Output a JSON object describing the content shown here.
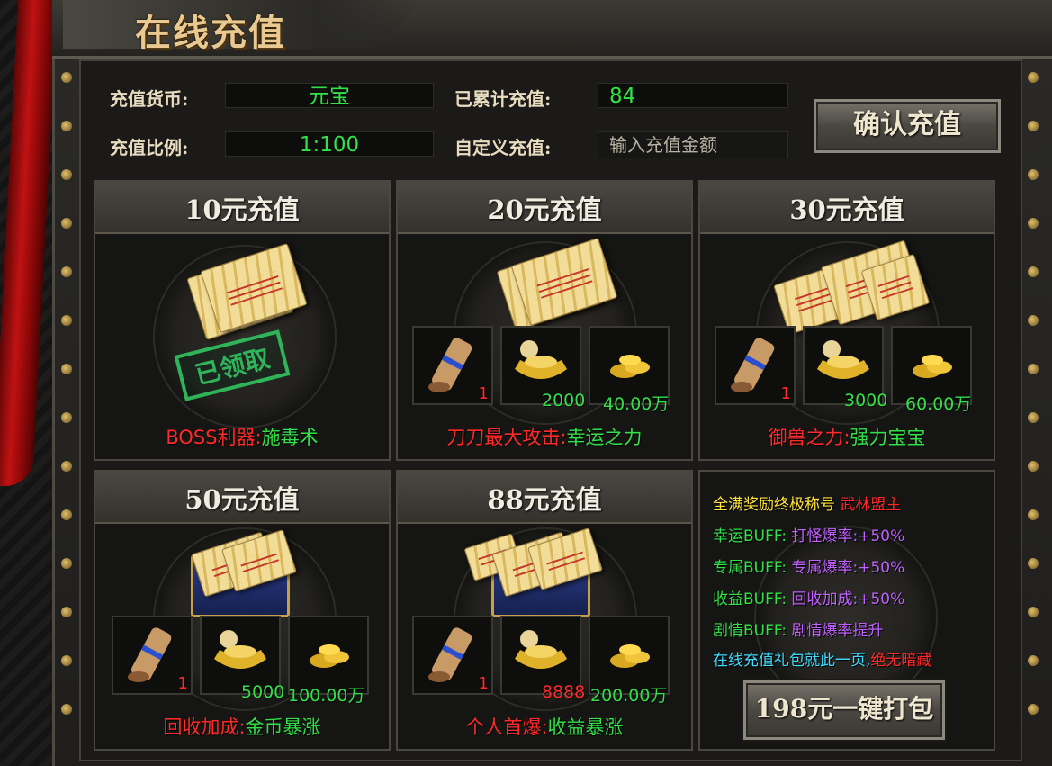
{
  "window": {
    "title": "在线充值"
  },
  "form": {
    "currency_label": "充值货币:",
    "currency_value": "元宝",
    "ratio_label": "充值比例:",
    "ratio_value": "1:100",
    "total_label": "已累计充值:",
    "total_value": "84",
    "custom_label": "自定义充值:",
    "custom_placeholder": "输入充值金额",
    "confirm_label": "确认充值"
  },
  "tiers": [
    {
      "title": "10元充值",
      "status": "已领取",
      "reward_prefix": "BOSS利器:",
      "reward_value": "施毒术"
    },
    {
      "title": "20元充值",
      "items": [
        {
          "icon": "scroll-icon",
          "qty": "1"
        },
        {
          "icon": "gold-ingot-icon",
          "qty": "2000"
        },
        {
          "icon": "gold-coins-icon",
          "qty": "40.00万"
        }
      ],
      "reward_prefix": "刀刀最大攻击:",
      "reward_value": "幸运之力"
    },
    {
      "title": "30元充值",
      "items": [
        {
          "icon": "scroll-icon",
          "qty": "1"
        },
        {
          "icon": "gold-ingot-icon",
          "qty": "3000"
        },
        {
          "icon": "gold-coins-icon",
          "qty": "60.00万"
        }
      ],
      "reward_prefix": "御兽之力:",
      "reward_value": "强力宝宝"
    },
    {
      "title": "50元充值",
      "items": [
        {
          "icon": "scroll-icon",
          "qty": "1"
        },
        {
          "icon": "gold-ingot-icon",
          "qty": "5000"
        },
        {
          "icon": "gold-coins-icon",
          "qty": "100.00万"
        }
      ],
      "reward_prefix": "回收加成:",
      "reward_value": "金币暴涨"
    },
    {
      "title": "88元充值",
      "items": [
        {
          "icon": "scroll-icon",
          "qty": "1"
        },
        {
          "icon": "gold-ingot-icon",
          "qty": "8888"
        },
        {
          "icon": "gold-coins-icon",
          "qty": "200.00万"
        }
      ],
      "reward_prefix": "个人首爆:",
      "reward_value": "收益暴涨"
    }
  ],
  "bonus": {
    "line1_prefix": "全满奖励终极称号",
    "line1_value": "武林盟主",
    "line2_prefix": "幸运BUFF:",
    "line2_value": "打怪爆率:+50%",
    "line3_prefix": "专属BUFF:",
    "line3_value": "专属爆率:+50%",
    "line4_prefix": "收益BUFF:",
    "line4_value": "回收加成:+50%",
    "line5_prefix": "剧情BUFF:",
    "line5_value": "剧情爆率提升",
    "line6_prefix": "在线充值礼包就此一页,",
    "line6_value": "绝无暗藏",
    "pack_button": "198元一键打包"
  },
  "colors": {
    "accent_green": "#33e048",
    "accent_red": "#ff2a2a",
    "title_gold": "#e9c98f",
    "buff_magenta": "#c060ff",
    "note_cyan": "#3fdcff",
    "title_yellow": "#ffe23a"
  }
}
